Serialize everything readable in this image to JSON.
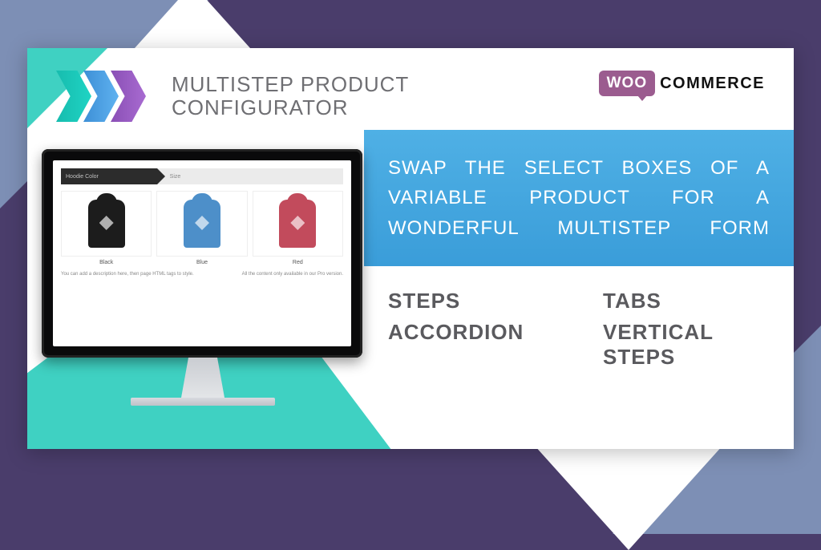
{
  "product": {
    "title_line1": "MULTISTEP PRODUCT",
    "title_line2": "CONFIGURATOR"
  },
  "platform": {
    "badge": "WOO",
    "name": "COMMERCE"
  },
  "promo_text": "SWAP THE SELECT BOXES OF A VARIABLE PRODUCT FOR A WONDERFUL MULTISTEP FORM",
  "features": [
    "STEPS",
    "TABS",
    "ACCORDION",
    "VERTICAL STEPS"
  ],
  "mock": {
    "step1_label": "Hoodie Color",
    "step2_label": "Size",
    "items": [
      {
        "label": "Black"
      },
      {
        "label": "Blue"
      },
      {
        "label": "Red"
      }
    ],
    "hint_left": "You can add a description here, then page HTML tags to style.",
    "hint_right": "All the content only available in our Pro version."
  }
}
